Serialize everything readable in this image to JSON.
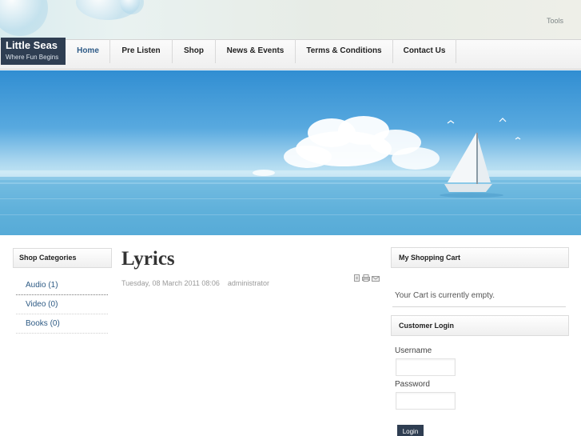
{
  "header": {
    "tools_label": "Tools",
    "logo_title": "Little Seas",
    "logo_tagline": "Where Fun Begins"
  },
  "nav": {
    "items": [
      {
        "label": "Home",
        "active": true
      },
      {
        "label": "Pre Listen"
      },
      {
        "label": "Shop"
      },
      {
        "label": "News & Events"
      },
      {
        "label": "Terms & Conditions"
      },
      {
        "label": "Contact Us"
      }
    ]
  },
  "sidebar": {
    "heading": "Shop Categories",
    "categories": [
      {
        "label": "Audio (1)"
      },
      {
        "label": "Video (0)"
      },
      {
        "label": "Books (0)"
      }
    ]
  },
  "article": {
    "title": "Lyrics",
    "date": "Tuesday, 08 March 2011 08:06",
    "author": "administrator",
    "action_icons": [
      "pdf-icon",
      "print-icon",
      "email-icon"
    ]
  },
  "cart": {
    "heading": "My Shopping Cart",
    "empty_text": "Your Cart is currently empty."
  },
  "login": {
    "heading": "Customer Login",
    "username_label": "Username",
    "username_value": "",
    "password_label": "Password",
    "password_value": "",
    "button_label": "Login"
  },
  "colors": {
    "brand_dark": "#2f3e52",
    "link_blue": "#2d5a84",
    "sky_blue": "#58a9df"
  }
}
